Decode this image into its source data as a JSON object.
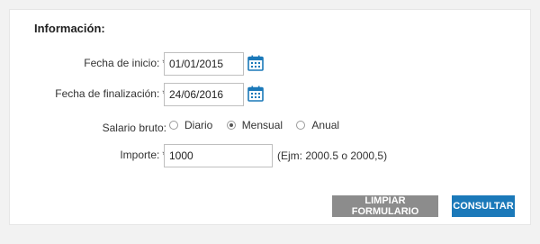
{
  "form": {
    "section_title": "Información:",
    "fecha_inicio": {
      "label": "Fecha de inicio:",
      "required_mark": "*",
      "value": "01/01/2015"
    },
    "fecha_fin": {
      "label": "Fecha de finalización:",
      "required_mark": "*",
      "value": "24/06/2016"
    },
    "salario": {
      "label": "Salario bruto:",
      "options": [
        "Diario",
        "Mensual",
        "Anual"
      ],
      "selected": "Mensual"
    },
    "importe": {
      "label": "Importe:",
      "required_mark": "*",
      "value": "1000",
      "hint": "(Ejm: 2000.5 o 2000,5)"
    }
  },
  "actions": {
    "clear_label": "LIMPIAR FORMULARIO",
    "submit_label": "CONSULTAR"
  },
  "colors": {
    "calendar_icon": "#1b79b9",
    "submit_button": "#1b79b9",
    "clear_button": "#8c8c8c"
  },
  "icons": {
    "calendar": "calendar-icon"
  }
}
